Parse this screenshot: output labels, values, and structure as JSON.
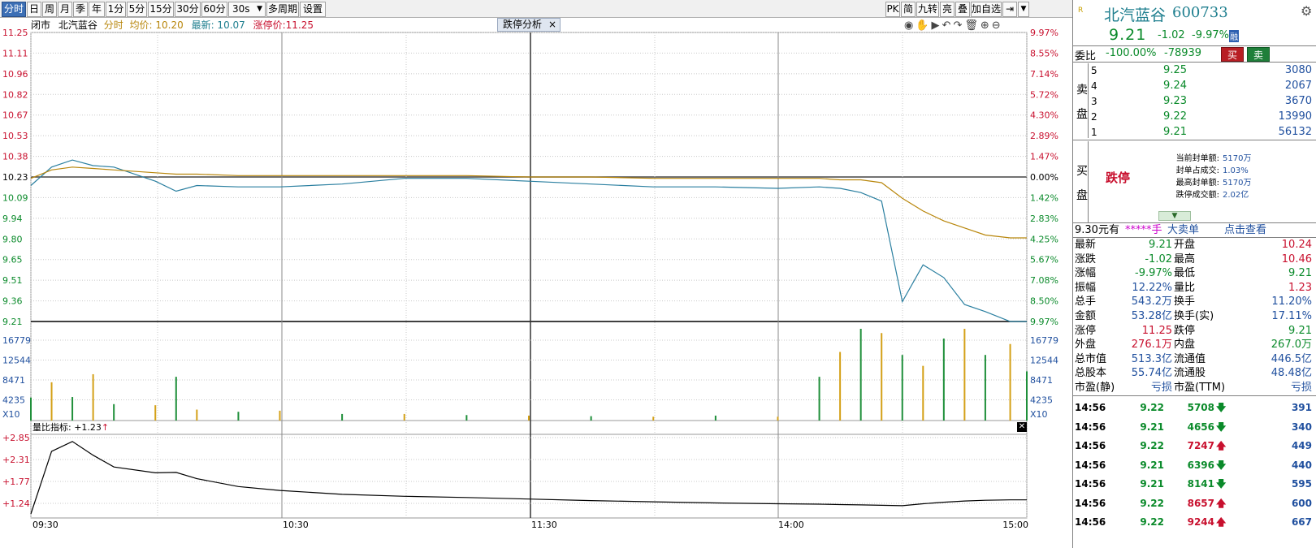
{
  "toolbar": {
    "periods": [
      "分时",
      "日",
      "周",
      "月",
      "季",
      "年",
      "1分",
      "5分",
      "15分",
      "30分",
      "60分",
      "30s"
    ],
    "active_period": "分时",
    "multi_period": "多周期",
    "settings": "设置",
    "right_buttons": [
      "PK",
      "简",
      "九转",
      "亮",
      "叠",
      "加自选"
    ]
  },
  "chart": {
    "status": "闭市",
    "stock_name": "北汽蓝谷",
    "mode": "分时",
    "avg_label": "均价: 10.20",
    "latest_label": "最新: 10.07",
    "limit_label": "涨停价:11.25",
    "analysis_tab": "跌停分析",
    "price_axis": [
      "11.25",
      "11.11",
      "10.96",
      "10.82",
      "10.67",
      "10.53",
      "10.38",
      "10.23",
      "10.09",
      "9.94",
      "9.80",
      "9.65",
      "9.51",
      "9.36",
      "9.21"
    ],
    "pct_axis": [
      "9.97%",
      "8.55%",
      "7.14%",
      "5.72%",
      "4.30%",
      "2.89%",
      "1.47%",
      "0.00%",
      "1.42%",
      "2.83%",
      "4.25%",
      "5.67%",
      "7.08%",
      "8.50%",
      "9.97%"
    ],
    "vol_axis": [
      "16779",
      "12544",
      "8471",
      "4235"
    ],
    "vol_unit": "X10",
    "indicator_label": "量比指标: +1.23",
    "indicator_axis": [
      "+2.85",
      "+2.31",
      "+1.77",
      "+1.24"
    ],
    "time_axis": [
      "09:30",
      "10:30",
      "11:30",
      "14:00",
      "15:00"
    ]
  },
  "chart_data": {
    "type": "line",
    "x": [
      "09:30",
      "09:35",
      "09:40",
      "09:45",
      "09:50",
      "10:00",
      "10:05",
      "10:10",
      "10:20",
      "10:30",
      "10:45",
      "11:00",
      "11:15",
      "11:30",
      "13:15",
      "13:30",
      "13:45",
      "14:00",
      "14:10",
      "14:15",
      "14:20",
      "14:25",
      "14:30",
      "14:35",
      "14:40",
      "14:45",
      "14:50",
      "14:56",
      "15:00"
    ],
    "series": [
      {
        "values": [
          10.17,
          10.3,
          10.35,
          10.31,
          10.3,
          10.2,
          10.13,
          10.17,
          10.16,
          10.16,
          10.18,
          10.22,
          10.22,
          10.2,
          10.18,
          10.16,
          10.16,
          10.15,
          10.16,
          10.15,
          10.12,
          10.06,
          9.35,
          9.61,
          9.52,
          9.33,
          9.28,
          9.21,
          9.21
        ]
      },
      {
        "values": [
          10.22,
          10.28,
          10.3,
          10.29,
          10.28,
          10.26,
          10.25,
          10.25,
          10.24,
          10.24,
          10.24,
          10.24,
          10.24,
          10.23,
          10.23,
          10.22,
          10.22,
          10.22,
          10.22,
          10.21,
          10.21,
          10.19,
          10.08,
          9.99,
          9.92,
          9.87,
          9.82,
          9.8,
          9.8
        ]
      }
    ],
    "ylim": [
      9.21,
      11.25
    ],
    "volume": [
      4200,
      7000,
      4300,
      8471,
      3000,
      2800,
      8000,
      2000,
      1600,
      1800,
      1200,
      1200,
      1000,
      900,
      800,
      700,
      900,
      700,
      8000,
      12544,
      16779,
      16000,
      12000,
      10000,
      15000,
      16779,
      12000,
      14000,
      9000
    ],
    "volume_ylim": [
      0,
      16779
    ],
    "indicator": [
      1.0,
      2.6,
      2.85,
      2.5,
      2.2,
      2.05,
      2.06,
      1.9,
      1.7,
      1.6,
      1.5,
      1.45,
      1.42,
      1.38,
      1.34,
      1.31,
      1.28,
      1.26,
      1.25,
      1.24,
      1.23,
      1.22,
      1.21,
      1.26,
      1.3,
      1.33,
      1.35,
      1.36,
      1.36
    ],
    "indicator_ylim": [
      0.98,
      2.95
    ]
  },
  "panel": {
    "stock_title": "北汽蓝谷",
    "stock_code": "600733",
    "price": "9.21",
    "change": "-1.02",
    "change_pct": "-9.97%",
    "wei_label": "委比",
    "wei_pct": "-100.00%",
    "wei_diff": "-78939",
    "buy_btn": "买",
    "sell_btn": "卖",
    "sell_label": [
      "卖",
      "盘"
    ],
    "asks": [
      {
        "level": "5",
        "price": "9.25",
        "vol": "3080"
      },
      {
        "level": "4",
        "price": "9.24",
        "vol": "2067"
      },
      {
        "level": "3",
        "price": "9.23",
        "vol": "3670"
      },
      {
        "level": "2",
        "price": "9.22",
        "vol": "13990"
      },
      {
        "level": "1",
        "price": "9.21",
        "vol": "56132"
      }
    ],
    "buy_label": [
      "买",
      "盘"
    ],
    "limit_state": "跌停",
    "seal_info": [
      {
        "k": "当前封单额:",
        "v": "5170万"
      },
      {
        "k": "封单占成交:",
        "v": "1.03%"
      },
      {
        "k": "最高封单额:",
        "v": "5170万"
      },
      {
        "k": "跌停成交额:",
        "v": "2.02亿"
      }
    ],
    "bigorder_price": "9.30元有",
    "bigorder_stars": "*****手",
    "bigorder_label": "大卖单",
    "bigorder_link": "点击查看",
    "stats": [
      {
        "k1": "最新",
        "v1": "9.21",
        "c1": "green",
        "k2": "开盘",
        "v2": "10.24",
        "c2": "red"
      },
      {
        "k1": "涨跌",
        "v1": "-1.02",
        "c1": "green",
        "k2": "最高",
        "v2": "10.46",
        "c2": "red"
      },
      {
        "k1": "涨幅",
        "v1": "-9.97%",
        "c1": "green",
        "k2": "最低",
        "v2": "9.21",
        "c2": "green"
      },
      {
        "k1": "振幅",
        "v1": "12.22%",
        "c1": "blue",
        "k2": "量比",
        "v2": "1.23",
        "c2": "red"
      },
      {
        "k1": "总手",
        "v1": "543.2万",
        "c1": "blue",
        "k2": "换手",
        "v2": "11.20%",
        "c2": "blue"
      },
      {
        "k1": "金额",
        "v1": "53.28亿",
        "c1": "blue",
        "k2": "换手(实)",
        "v2": "17.11%",
        "c2": "blue"
      },
      {
        "k1": "涨停",
        "v1": "11.25",
        "c1": "red",
        "k2": "跌停",
        "v2": "9.21",
        "c2": "green"
      },
      {
        "k1": "外盘",
        "v1": "276.1万",
        "c1": "red",
        "k2": "内盘",
        "v2": "267.0万",
        "c2": "green"
      },
      {
        "k1": "总市值",
        "v1": "513.3亿",
        "c1": "blue",
        "k2": "流通值",
        "v2": "446.5亿",
        "c2": "blue"
      },
      {
        "k1": "总股本",
        "v1": "55.74亿",
        "c1": "blue",
        "k2": "流通股",
        "v2": "48.48亿",
        "c2": "blue"
      },
      {
        "k1": "市盈(静)",
        "v1": "亏损",
        "c1": "blue",
        "k2": "市盈(TTM)",
        "v2": "亏损",
        "c2": "blue"
      }
    ],
    "ticks": [
      {
        "time": "14:56",
        "price": "9.22",
        "vol": "5708",
        "dir": "down",
        "n": "391"
      },
      {
        "time": "14:56",
        "price": "9.21",
        "vol": "4656",
        "dir": "down",
        "n": "340"
      },
      {
        "time": "14:56",
        "price": "9.22",
        "vol": "7247",
        "dir": "up",
        "n": "449"
      },
      {
        "time": "14:56",
        "price": "9.21",
        "vol": "6396",
        "dir": "down",
        "n": "440"
      },
      {
        "time": "14:56",
        "price": "9.21",
        "vol": "8141",
        "dir": "down",
        "n": "595"
      },
      {
        "time": "14:56",
        "price": "9.22",
        "vol": "8657",
        "dir": "up",
        "n": "600"
      },
      {
        "time": "14:56",
        "price": "9.22",
        "vol": "9244",
        "dir": "up",
        "n": "667"
      }
    ]
  }
}
